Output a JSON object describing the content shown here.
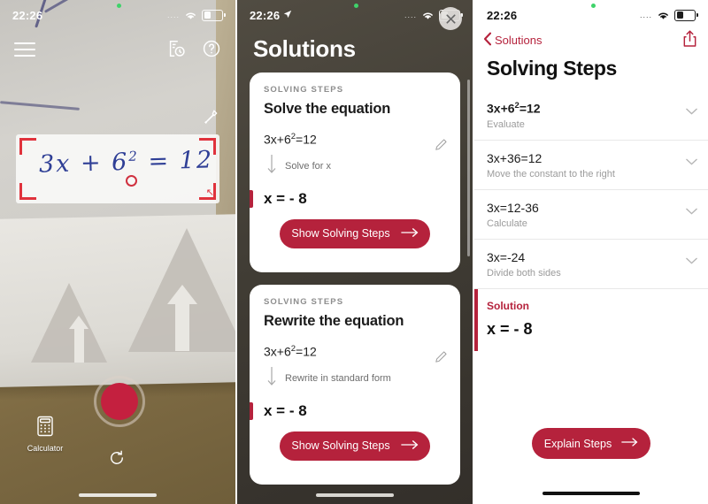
{
  "panel_camera": {
    "status": {
      "time": "22:26",
      "dots": "....",
      "wifi_icon": "wifi-icon",
      "battery_icon": "battery-icon"
    },
    "menu_icon": "hamburger-menu-icon",
    "history_icon": "history-icon",
    "help_icon": "help-icon",
    "flashlight_icon": "flashlight-icon",
    "scan": {
      "equation_base": "3x + 6",
      "equation_exp": "2",
      "equation_tail": " = 12",
      "frame_icon": "scan-frame-corner"
    },
    "shutter_label": "shutter-button",
    "calculator_label": "Calculator",
    "undo_icon": "undo-icon"
  },
  "panel_solutions": {
    "status": {
      "time": "22:26",
      "location_icon": "location-arrow-icon",
      "dots": "....",
      "wifi_icon": "wifi-icon",
      "battery_icon": "battery-icon"
    },
    "title": "Solutions",
    "close_icon": "close-icon",
    "cards": [
      {
        "kicker": "SOLVING STEPS",
        "title": "Solve the equation",
        "equation_base": "3x+6",
        "equation_exp": "2",
        "equation_tail": "=12",
        "edit_icon": "pencil-icon",
        "step_note": "Solve for x",
        "answer": "x = - 8",
        "cta": "Show Solving Steps"
      },
      {
        "kicker": "SOLVING STEPS",
        "title": "Rewrite the equation",
        "equation_base": "3x+6",
        "equation_exp": "2",
        "equation_tail": "=12",
        "edit_icon": "pencil-icon",
        "step_note": "Rewrite in standard form",
        "answer": "x = - 8",
        "cta": "Show Solving Steps"
      }
    ]
  },
  "panel_steps": {
    "status": {
      "time": "22:26",
      "dots": "....",
      "wifi_icon": "wifi-icon",
      "battery_icon": "battery-icon"
    },
    "back_label": "Solutions",
    "back_icon": "chevron-left-icon",
    "share_icon": "share-icon",
    "title": "Solving Steps",
    "steps": [
      {
        "eq_base": "3x+6",
        "eq_exp": "2",
        "eq_tail": "=12",
        "desc": "Evaluate",
        "chevron": "chevron-down-icon"
      },
      {
        "eq_base": "3x+36=12",
        "eq_exp": "",
        "eq_tail": "",
        "desc": "Move the constant to the right",
        "chevron": "chevron-down-icon"
      },
      {
        "eq_base": "3x=12-36",
        "eq_exp": "",
        "eq_tail": "",
        "desc": "Calculate",
        "chevron": "chevron-down-icon"
      },
      {
        "eq_base": "3x=-24",
        "eq_exp": "",
        "eq_tail": "",
        "desc": "Divide both sides",
        "chevron": "chevron-down-icon"
      }
    ],
    "solution_label": "Solution",
    "solution_value": "x = - 8",
    "explain_cta": "Explain Steps"
  },
  "colors": {
    "accent": "#b5223c",
    "scan_corner": "#e0323c",
    "ink": "#2f3f96"
  }
}
